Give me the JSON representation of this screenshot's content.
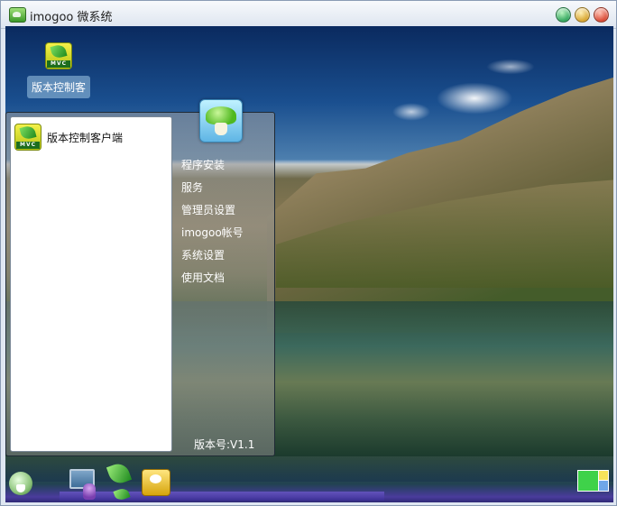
{
  "window": {
    "title": "imogoo 微系统"
  },
  "desktop": {
    "icons": [
      {
        "label": "版本控制客",
        "icon": "mvc-leaf-icon",
        "icon_text": "MVC"
      }
    ]
  },
  "start_menu": {
    "programs": [
      {
        "label": "版本控制客户端",
        "icon": "mvc-leaf-icon",
        "icon_text": "MVC"
      }
    ],
    "items": [
      {
        "label": "程序安装"
      },
      {
        "label": "服务"
      },
      {
        "label": "管理员设置"
      },
      {
        "label": "imogoo帐号"
      },
      {
        "label": "系统设置"
      },
      {
        "label": "使用文档"
      }
    ],
    "version": "版本号:V1.1"
  },
  "taskbar": {
    "icons": [
      "start-mushroom-icon",
      "monitor-icon",
      "user-icon",
      "leaf-icon",
      "app-icon",
      "tray-icon"
    ]
  },
  "colors": {
    "menu_bg": "#8c8c8c",
    "titlebar": "#dde5ef",
    "taskbar_bottom": "#2f2a76"
  }
}
